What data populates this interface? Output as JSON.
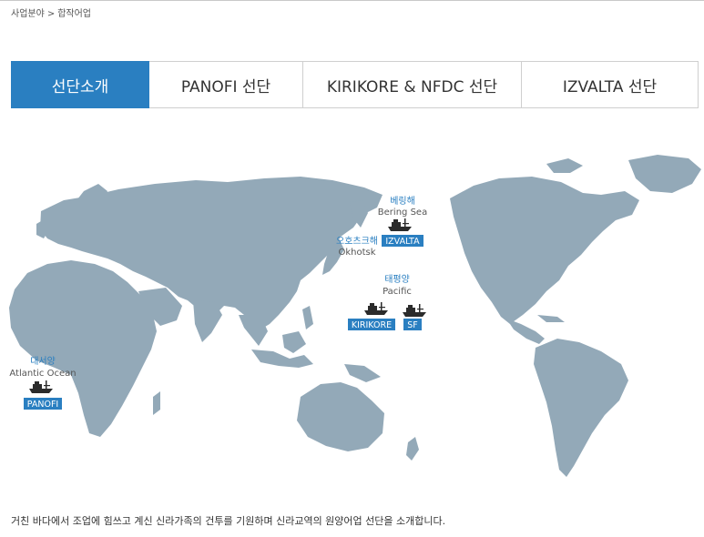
{
  "breadcrumb": {
    "section": "사업분야",
    "separator": ">",
    "current": "합작어업"
  },
  "tabs": [
    {
      "label": "선단소개",
      "active": true
    },
    {
      "label": "PANOFI 선단",
      "active": false
    },
    {
      "label": "KIRIKORE & NFDC 선단",
      "active": false
    },
    {
      "label": "IZVALTA 선단",
      "active": false
    }
  ],
  "map": {
    "land_color": "#93a9b8",
    "accent_color": "#2a7fc1",
    "regions": {
      "bering": {
        "ko": "베링해",
        "en": "Bering Sea"
      },
      "okhotsk": {
        "ko": "오호츠크해",
        "en": "Okhotsk"
      },
      "pacific": {
        "ko": "태평양",
        "en": "Pacific"
      },
      "atlantic": {
        "ko": "대서양",
        "en": "Atlantic Ocean"
      }
    },
    "fleets": {
      "izvalta": "IZVALTA",
      "kirikore": "KIRIKORE",
      "sf": "SF",
      "panofi": "PANOFI"
    }
  },
  "description": "거친 바다에서 조업에 힘쓰고 계신 신라가족의 건투를 기원하며 신라교역의 원양어업 선단을 소개합니다."
}
